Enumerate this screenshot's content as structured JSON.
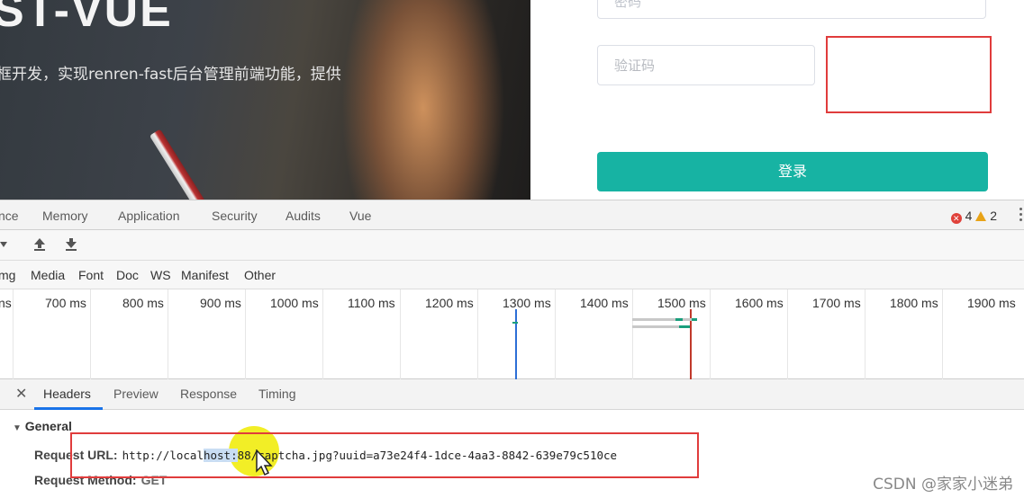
{
  "hero": {
    "title": "ST-VUE",
    "description": "框开发，实现renren-fast后台管理前端功能，提供"
  },
  "login": {
    "password_placeholder": "密码",
    "captcha_placeholder": "验证码",
    "submit_label": "登录"
  },
  "devtools": {
    "tabs": [
      "nce",
      "Memory",
      "Application",
      "Security",
      "Audits",
      "Vue"
    ],
    "error_count": "4",
    "warning_count": "2",
    "filters": [
      "mg",
      "Media",
      "Font",
      "Doc",
      "WS",
      "Manifest",
      "Other"
    ],
    "timeline_ticks": [
      "ns",
      "700 ms",
      "800 ms",
      "900 ms",
      "1000 ms",
      "1100 ms",
      "1200 ms",
      "1300 ms",
      "1400 ms",
      "1500 ms",
      "1600 ms",
      "1700 ms",
      "1800 ms",
      "1900 ms"
    ],
    "detail_tabs": [
      "Headers",
      "Preview",
      "Response",
      "Timing"
    ],
    "active_detail_tab": "Headers",
    "general_section": "General",
    "request_url_label": "Request URL:",
    "request_url_prefix": "http://local",
    "request_url_highlight": "host:",
    "request_url_port": "88",
    "request_url_rest": "/captcha.jpg?uuid=a73e24f4-1dce-4aa3-8842-639e79c510ce",
    "request_method_label": "Request Method:",
    "request_method_value": "GET"
  },
  "watermark": "CSDN @家家小迷弟",
  "colors": {
    "accent": "#17b3a3",
    "highlight_box": "#e03c3c",
    "tab_underline": "#1a73e8"
  }
}
